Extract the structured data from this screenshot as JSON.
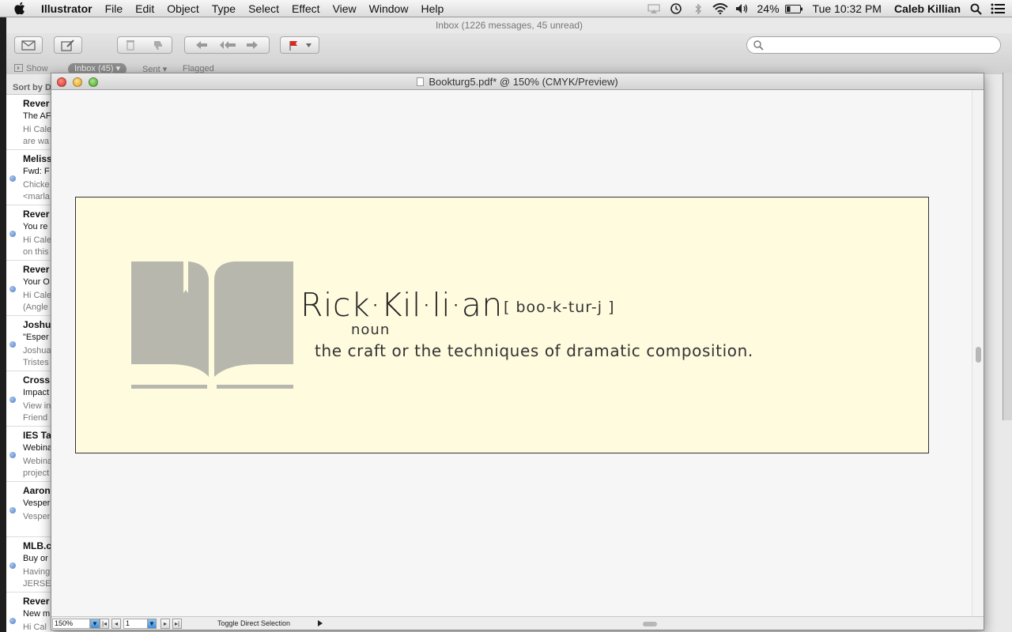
{
  "menubar": {
    "app_name": "Illustrator",
    "items": [
      "File",
      "Edit",
      "Object",
      "Type",
      "Select",
      "Effect",
      "View",
      "Window",
      "Help"
    ],
    "battery": "24%",
    "clock": "Tue 10:32 PM",
    "user": "Caleb Killian"
  },
  "mail": {
    "title": "Inbox (1226 messages, 45 unread)",
    "filter": {
      "show": "Show",
      "inbox": "Inbox (45)",
      "sent": "Sent",
      "flagged": "Flagged"
    },
    "sort_label": "Sort by D",
    "messages": [
      {
        "from": "Rever",
        "subject": "The AF",
        "preview": "Hi Cale\nare wa",
        "unread": false
      },
      {
        "from": "Meliss",
        "subject": "Fwd: F",
        "preview": "Chicke\n<marla",
        "unread": true
      },
      {
        "from": "Rever",
        "subject": "You re",
        "preview": "Hi Cale\non this",
        "unread": true
      },
      {
        "from": "Rever",
        "subject": "Your O",
        "preview": "Hi Cale\n(Angle",
        "unread": true
      },
      {
        "from": "Joshu",
        "subject": "\"Esper",
        "preview": "Joshua\nTristes",
        "unread": true
      },
      {
        "from": "Cross",
        "subject": "Impact",
        "preview": "View in\nFriend",
        "unread": true
      },
      {
        "from": "IES Ta",
        "subject": "Webina",
        "preview": "Webina\nproject",
        "unread": true
      },
      {
        "from": "Aaron",
        "subject": "Vesper",
        "preview": "Vesper",
        "unread": true
      },
      {
        "from": "MLB.c",
        "subject": "Buy or",
        "preview": "Having\nJERSE",
        "unread": true
      },
      {
        "from": "Rever",
        "subject": "New m",
        "preview": "Hi Cal",
        "unread": true
      }
    ]
  },
  "document": {
    "title": "Bookturg5.pdf* @ 150% (CMYK/Preview)",
    "zoom": "150%",
    "page": "1",
    "status_label": "Toggle Direct Selection"
  },
  "artboard": {
    "headword": "Rick·Kil·li·an",
    "pronunciation": "[ boo-k-tur-j ]",
    "part_of_speech": "noun",
    "definition": "the craft or the techniques of dramatic composition.",
    "logo_color": "#b8b7ad",
    "background": "#fffbdf"
  }
}
